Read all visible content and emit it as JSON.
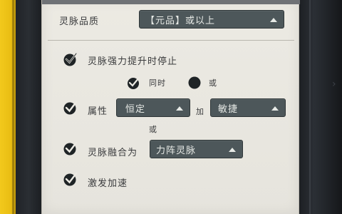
{
  "quality_row": {
    "label": "灵脉品质",
    "dropdown_value": "【元品】或以上"
  },
  "options": {
    "stop_on_upgrade": {
      "label": "灵脉强力提升时停止",
      "checked": true
    },
    "logic_radio": {
      "options": [
        {
          "label": "同时",
          "selected": true
        },
        {
          "label": "或",
          "selected": false
        }
      ]
    },
    "attribute": {
      "checked": true,
      "label": "属性",
      "first_value": "恒定",
      "plus_symbol": "加",
      "second_value": "敏捷",
      "or_label": "或"
    },
    "spirit_vein_merge": {
      "checked": true,
      "label": "灵脉融合为",
      "value": "力阵灵脉"
    },
    "activate_speedup": {
      "checked": true,
      "label": "激发加速"
    }
  },
  "colors": {
    "panel_bg": "#eceae3",
    "dropdown_bg": "#4d575a",
    "accent_yellow": "#f2c91d",
    "check_dark": "#1f2426"
  }
}
